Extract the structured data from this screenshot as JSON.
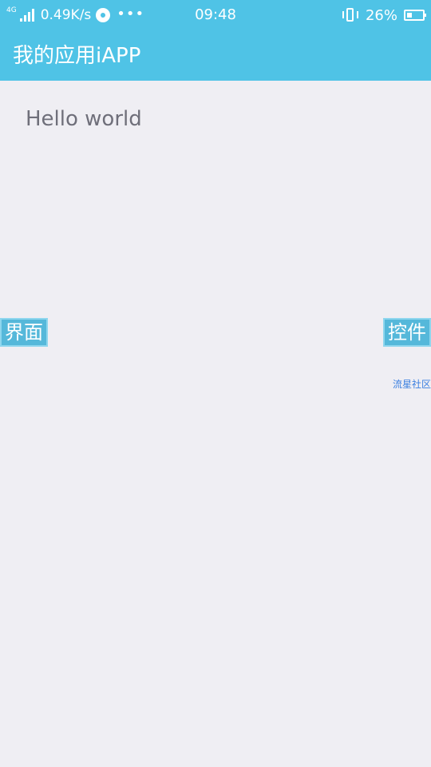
{
  "status_bar": {
    "network_type": "4G",
    "net_speed": "0.49K/s",
    "more_indicator": "•••",
    "clock": "09:48",
    "battery_percent": "26%",
    "battery_level": 0.26,
    "icons": [
      "signal-icon",
      "disc-icon",
      "vibrate-icon",
      "battery-icon"
    ]
  },
  "app_bar": {
    "title": "我的应用iAPP"
  },
  "main": {
    "hello_text": "Hello world",
    "left_button_label": "界面",
    "right_button_label": "控件",
    "community_link": "流星社区"
  },
  "colors": {
    "primary": "#4fc3e6",
    "background": "#efeef3",
    "button_fill": "#55b8da",
    "button_border": "#8ed6ee",
    "link": "#3a7fe0",
    "hello_text": "#6f6f7a"
  }
}
